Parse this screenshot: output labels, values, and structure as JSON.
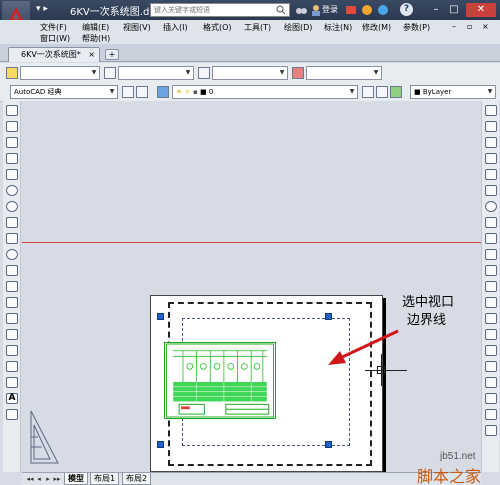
{
  "titlebar": {
    "doc_title": "6KV一次系统图.dwg",
    "search_placeholder": "键入关键字或短语",
    "login_label": "登录",
    "help_label": "?"
  },
  "menu": {
    "row1": [
      "文件(F)",
      "编辑(E)",
      "视图(V)",
      "插入(I)",
      "格式(O)",
      "工具(T)",
      "绘图(D)",
      "标注(N)",
      "修改(M)",
      "参数(P)"
    ],
    "row2": [
      "窗口(W)",
      "帮助(H)"
    ]
  },
  "tabs": {
    "doc_tab": "6KV一次系统图*",
    "close": "×",
    "new_tab": "+"
  },
  "toolbar2": {
    "workspace": "AutoCAD 经典",
    "layer_value": "0",
    "bylayer": "ByLayer"
  },
  "annotation": {
    "line1": "选中视口",
    "line2": "边界线"
  },
  "layout_tabs": [
    "模型",
    "布局1",
    "布局2"
  ],
  "watermark": {
    "url": "jb51.net",
    "name": "脚本之家"
  }
}
